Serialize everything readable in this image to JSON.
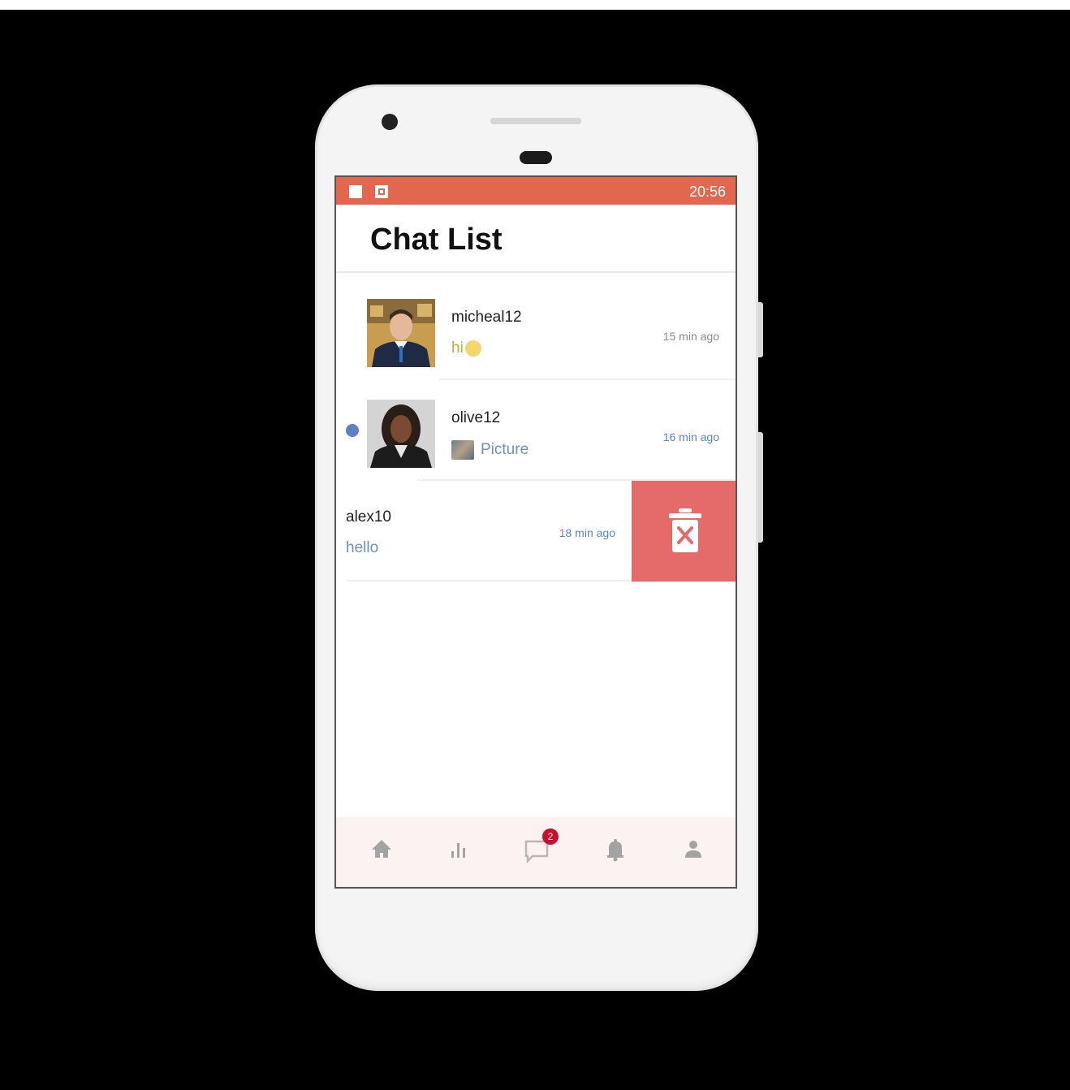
{
  "status_bar": {
    "time": "20:56"
  },
  "header": {
    "title": "Chat List"
  },
  "chats": [
    {
      "username": "micheal12",
      "preview": "hi",
      "time": "15 min ago",
      "unread": false
    },
    {
      "username": "olive12",
      "preview": "Picture",
      "time": "16 min ago",
      "unread": true
    },
    {
      "username": "alex10",
      "preview": "hello",
      "time": "18 min ago",
      "unread": false
    }
  ],
  "swipe_action": {
    "icon": "trash-icon"
  },
  "bottom_nav": {
    "items": [
      {
        "icon": "home-icon"
      },
      {
        "icon": "bar-chart-icon"
      },
      {
        "icon": "chat-icon",
        "badge": "2",
        "active": true
      },
      {
        "icon": "bell-icon"
      },
      {
        "icon": "profile-icon"
      }
    ]
  },
  "colors": {
    "accent": "#e2674f",
    "delete": "#e56a6a",
    "link": "#6e8fbd",
    "badge": "#c8102e"
  }
}
